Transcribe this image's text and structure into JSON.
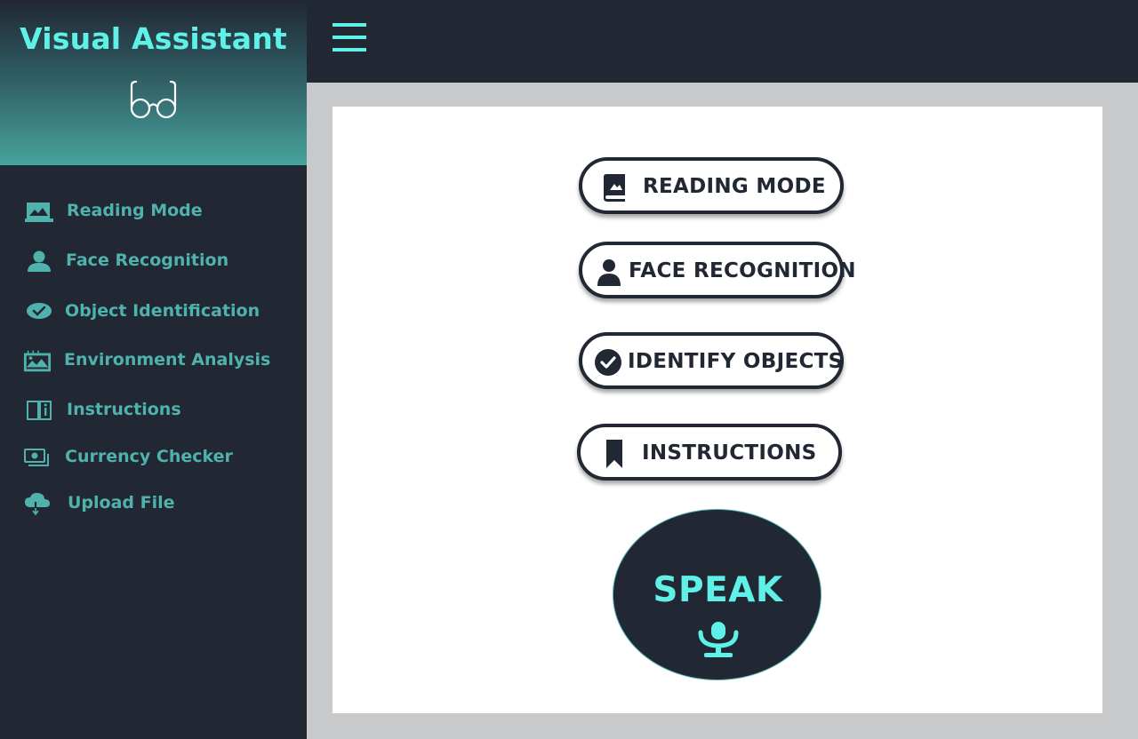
{
  "app": {
    "title": "Visual Assistant",
    "brand_icon": "glasses-icon"
  },
  "colors": {
    "accent": "#5ff1e8",
    "sidebar_text": "#4fb2ac",
    "dark": "#212733",
    "page_bg": "#c8c9cb",
    "card_bg": "#ffffff"
  },
  "topbar": {
    "menu_icon": "hamburger-icon"
  },
  "sidebar": {
    "items": [
      {
        "label": "Reading Mode",
        "icon": "book-image-icon"
      },
      {
        "label": "Face Recognition",
        "icon": "user-icon"
      },
      {
        "label": "Object Identification",
        "icon": "eye-check-icon"
      },
      {
        "label": "Environment Analysis",
        "icon": "landscape-icon"
      },
      {
        "label": "Instructions",
        "icon": "book-info-icon"
      },
      {
        "label": "Currency Checker",
        "icon": "money-icon"
      },
      {
        "label": "Upload File",
        "icon": "cloud-download-icon"
      }
    ]
  },
  "main": {
    "buttons": [
      {
        "label": "READING MODE",
        "icon": "book-icon"
      },
      {
        "label": "FACE RECOGNITION",
        "icon": "user-icon"
      },
      {
        "label": "IDENTIFY OBJECTS",
        "icon": "check-circle-icon"
      },
      {
        "label": "INSTRUCTIONS",
        "icon": "bookmark-icon"
      }
    ],
    "speak": {
      "label": "SPEAK",
      "icon": "microphone-icon"
    }
  }
}
